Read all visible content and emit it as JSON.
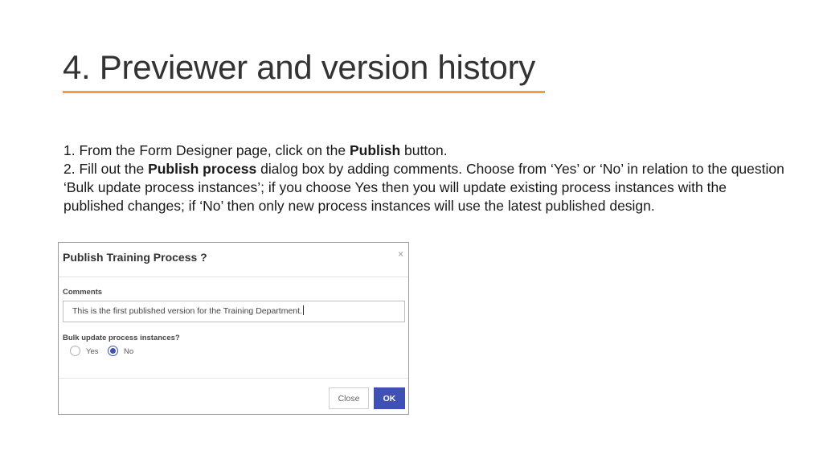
{
  "slide": {
    "title": "4. Previewer and version history",
    "accent_color": "#f0a040"
  },
  "instructions": {
    "step1": {
      "prefix": "1. From the Form Designer page, click on the ",
      "bold": "Publish",
      "suffix": " button."
    },
    "step2": {
      "prefix": "2. Fill out the ",
      "bold": "Publish process",
      "suffix": " dialog box by adding comments. Choose from ‘Yes’ or ‘No’ in relation to the question ‘Bulk update process instances’; if you choose Yes then you will update existing process instances with the published changes; if ‘No’ then only new process instances will use the latest published design."
    }
  },
  "dialog": {
    "title": "Publish Training Process ?",
    "close_glyph": "×",
    "comments_label": "Comments",
    "comments_value": "This is the first published version for the Training Department.",
    "bulk_label": "Bulk update process instances?",
    "options": [
      {
        "label": "Yes",
        "checked": false
      },
      {
        "label": "No",
        "checked": true
      }
    ],
    "close_button": "Close",
    "ok_button": "OK",
    "primary_color": "#3f51b5"
  }
}
